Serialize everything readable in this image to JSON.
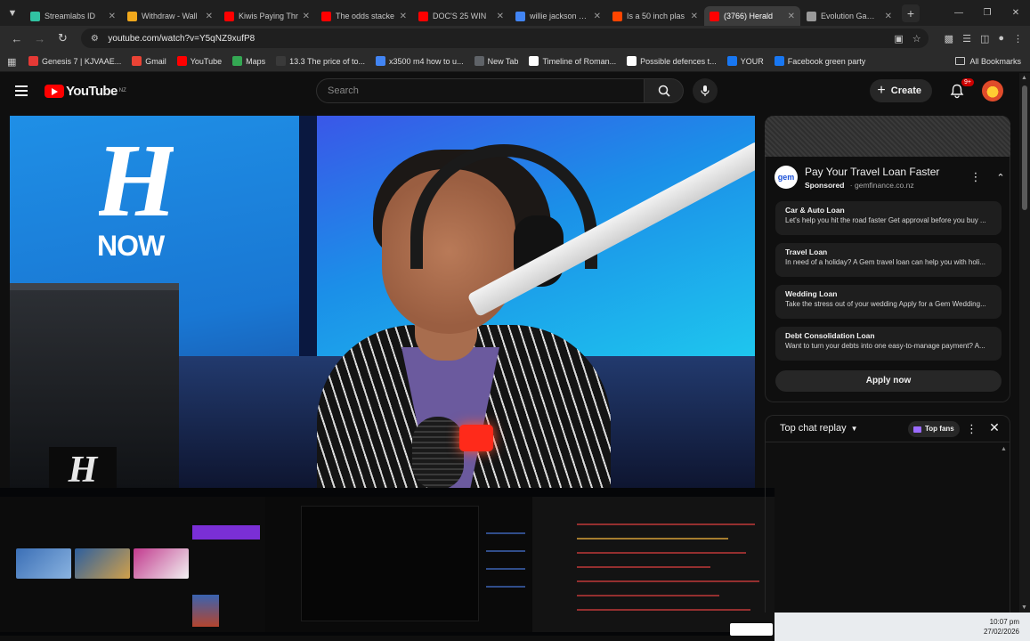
{
  "browser": {
    "tabs": [
      {
        "title": "Streamlabs ID",
        "icon_color": "#31c3a2",
        "active": false
      },
      {
        "title": "Withdraw - Wall",
        "icon_color": "#f0a81c",
        "active": false
      },
      {
        "title": "Kiwis Paying Thr",
        "icon_color": "#ff0000",
        "active": false
      },
      {
        "title": "The odds stacke",
        "icon_color": "#ff0000",
        "active": false
      },
      {
        "title": "DOC'S 25 WIN",
        "icon_color": "#ff0000",
        "active": false
      },
      {
        "title": "willie jackson age",
        "icon_color": "#4285f4",
        "active": false
      },
      {
        "title": "Is a 50 inch plas",
        "icon_color": "#ff4500",
        "active": false
      },
      {
        "title": "(3766) Herald",
        "icon_color": "#ff0000",
        "active": true
      },
      {
        "title": "Evolution Gaming",
        "icon_color": "#9a9a9a",
        "active": false
      }
    ],
    "new_tab_label": "+",
    "url": "youtube.com/watch?v=Y5qNZ9xufP8",
    "bookmarks": [
      {
        "label": "Genesis 7 | KJVAAE...",
        "icon_color": "#e53935"
      },
      {
        "label": "Gmail",
        "icon_color": "#ea4335"
      },
      {
        "label": "YouTube",
        "icon_color": "#ff0000"
      },
      {
        "label": "Maps",
        "icon_color": "#34a853"
      },
      {
        "label": "13.3 The price of to...",
        "icon_color": "#3a3a3a"
      },
      {
        "label": "x3500 m4 how to u...",
        "icon_color": "#4285f4"
      },
      {
        "label": "New Tab",
        "icon_color": "#5f6368"
      },
      {
        "label": "Timeline of Roman...",
        "icon_color": "#ffffff"
      },
      {
        "label": "Possible defences t...",
        "icon_color": "#ffffff"
      },
      {
        "label": "YOUR",
        "icon_color": "#1877f2"
      },
      {
        "label": "Facebook green party",
        "icon_color": "#1877f2"
      }
    ],
    "all_bookmarks_label": "All Bookmarks"
  },
  "youtube": {
    "logo_text": "YouTube",
    "region": "NZ",
    "search_placeholder": "Search",
    "create_label": "Create",
    "notification_badge": "9+"
  },
  "video": {
    "brand_letter": "H",
    "brand_text": "NOW"
  },
  "ad": {
    "logo_text": "gem",
    "title": "Pay Your Travel Loan Faster",
    "sponsored_label": "Sponsored",
    "domain": "gemfinance.co.nz",
    "items": [
      {
        "title": "Car & Auto Loan",
        "desc": "Let's help you hit the road faster Get approval before you buy ..."
      },
      {
        "title": "Travel Loan",
        "desc": "In need of a holiday? A Gem travel loan can help you with holi..."
      },
      {
        "title": "Wedding Loan",
        "desc": "Take the stress out of your wedding Apply for a Gem Wedding..."
      },
      {
        "title": "Debt Consolidation Loan",
        "desc": "Want to turn your debts into one easy-to-manage payment? A..."
      }
    ],
    "apply_label": "Apply now"
  },
  "chat": {
    "title": "Top chat replay",
    "top_fans_label": "Top fans"
  },
  "taskbar": {
    "time": "10:07 pm",
    "date": "27/02/2026"
  }
}
